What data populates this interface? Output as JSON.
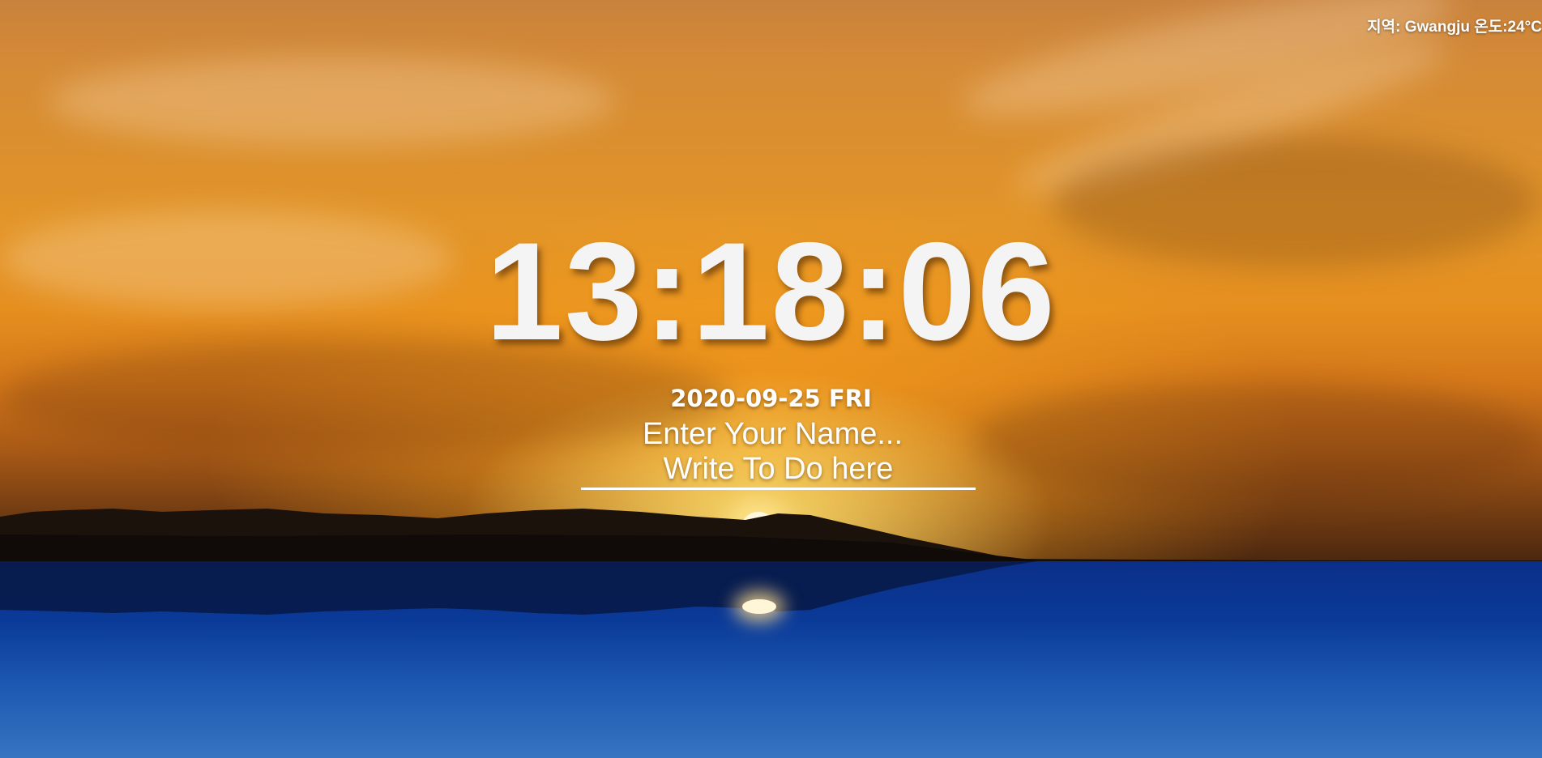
{
  "weather": {
    "region_label": "지역:",
    "region": "Gwangju",
    "temp_label": "온도:",
    "temperature": "24°C"
  },
  "clock": {
    "time": "13:18:06"
  },
  "date": {
    "text": "2020-09-25 FRI"
  },
  "name_form": {
    "placeholder": "Enter Your Name..."
  },
  "todo_form": {
    "placeholder": "Write To Do here"
  },
  "colors": {
    "text": "#ffffff",
    "clock": "#f4f4f4"
  }
}
